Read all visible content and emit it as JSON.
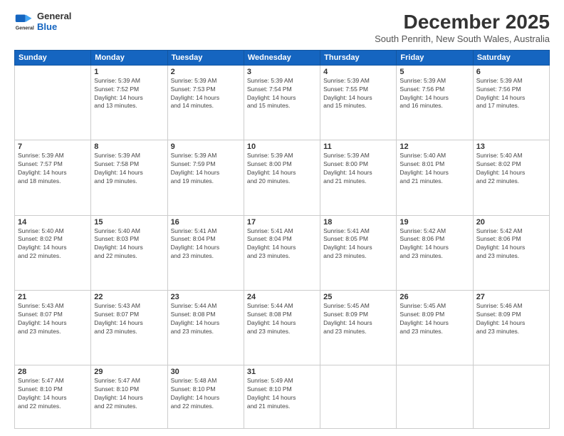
{
  "logo": {
    "line1": "General",
    "line2": "Blue"
  },
  "title": "December 2025",
  "subtitle": "South Penrith, New South Wales, Australia",
  "days_header": [
    "Sunday",
    "Monday",
    "Tuesday",
    "Wednesday",
    "Thursday",
    "Friday",
    "Saturday"
  ],
  "weeks": [
    [
      {
        "num": "",
        "info": ""
      },
      {
        "num": "1",
        "info": "Sunrise: 5:39 AM\nSunset: 7:52 PM\nDaylight: 14 hours\nand 13 minutes."
      },
      {
        "num": "2",
        "info": "Sunrise: 5:39 AM\nSunset: 7:53 PM\nDaylight: 14 hours\nand 14 minutes."
      },
      {
        "num": "3",
        "info": "Sunrise: 5:39 AM\nSunset: 7:54 PM\nDaylight: 14 hours\nand 15 minutes."
      },
      {
        "num": "4",
        "info": "Sunrise: 5:39 AM\nSunset: 7:55 PM\nDaylight: 14 hours\nand 15 minutes."
      },
      {
        "num": "5",
        "info": "Sunrise: 5:39 AM\nSunset: 7:56 PM\nDaylight: 14 hours\nand 16 minutes."
      },
      {
        "num": "6",
        "info": "Sunrise: 5:39 AM\nSunset: 7:56 PM\nDaylight: 14 hours\nand 17 minutes."
      }
    ],
    [
      {
        "num": "7",
        "info": "Sunrise: 5:39 AM\nSunset: 7:57 PM\nDaylight: 14 hours\nand 18 minutes."
      },
      {
        "num": "8",
        "info": "Sunrise: 5:39 AM\nSunset: 7:58 PM\nDaylight: 14 hours\nand 19 minutes."
      },
      {
        "num": "9",
        "info": "Sunrise: 5:39 AM\nSunset: 7:59 PM\nDaylight: 14 hours\nand 19 minutes."
      },
      {
        "num": "10",
        "info": "Sunrise: 5:39 AM\nSunset: 8:00 PM\nDaylight: 14 hours\nand 20 minutes."
      },
      {
        "num": "11",
        "info": "Sunrise: 5:39 AM\nSunset: 8:00 PM\nDaylight: 14 hours\nand 21 minutes."
      },
      {
        "num": "12",
        "info": "Sunrise: 5:40 AM\nSunset: 8:01 PM\nDaylight: 14 hours\nand 21 minutes."
      },
      {
        "num": "13",
        "info": "Sunrise: 5:40 AM\nSunset: 8:02 PM\nDaylight: 14 hours\nand 22 minutes."
      }
    ],
    [
      {
        "num": "14",
        "info": "Sunrise: 5:40 AM\nSunset: 8:02 PM\nDaylight: 14 hours\nand 22 minutes."
      },
      {
        "num": "15",
        "info": "Sunrise: 5:40 AM\nSunset: 8:03 PM\nDaylight: 14 hours\nand 22 minutes."
      },
      {
        "num": "16",
        "info": "Sunrise: 5:41 AM\nSunset: 8:04 PM\nDaylight: 14 hours\nand 23 minutes."
      },
      {
        "num": "17",
        "info": "Sunrise: 5:41 AM\nSunset: 8:04 PM\nDaylight: 14 hours\nand 23 minutes."
      },
      {
        "num": "18",
        "info": "Sunrise: 5:41 AM\nSunset: 8:05 PM\nDaylight: 14 hours\nand 23 minutes."
      },
      {
        "num": "19",
        "info": "Sunrise: 5:42 AM\nSunset: 8:06 PM\nDaylight: 14 hours\nand 23 minutes."
      },
      {
        "num": "20",
        "info": "Sunrise: 5:42 AM\nSunset: 8:06 PM\nDaylight: 14 hours\nand 23 minutes."
      }
    ],
    [
      {
        "num": "21",
        "info": "Sunrise: 5:43 AM\nSunset: 8:07 PM\nDaylight: 14 hours\nand 23 minutes."
      },
      {
        "num": "22",
        "info": "Sunrise: 5:43 AM\nSunset: 8:07 PM\nDaylight: 14 hours\nand 23 minutes."
      },
      {
        "num": "23",
        "info": "Sunrise: 5:44 AM\nSunset: 8:08 PM\nDaylight: 14 hours\nand 23 minutes."
      },
      {
        "num": "24",
        "info": "Sunrise: 5:44 AM\nSunset: 8:08 PM\nDaylight: 14 hours\nand 23 minutes."
      },
      {
        "num": "25",
        "info": "Sunrise: 5:45 AM\nSunset: 8:09 PM\nDaylight: 14 hours\nand 23 minutes."
      },
      {
        "num": "26",
        "info": "Sunrise: 5:45 AM\nSunset: 8:09 PM\nDaylight: 14 hours\nand 23 minutes."
      },
      {
        "num": "27",
        "info": "Sunrise: 5:46 AM\nSunset: 8:09 PM\nDaylight: 14 hours\nand 23 minutes."
      }
    ],
    [
      {
        "num": "28",
        "info": "Sunrise: 5:47 AM\nSunset: 8:10 PM\nDaylight: 14 hours\nand 22 minutes."
      },
      {
        "num": "29",
        "info": "Sunrise: 5:47 AM\nSunset: 8:10 PM\nDaylight: 14 hours\nand 22 minutes."
      },
      {
        "num": "30",
        "info": "Sunrise: 5:48 AM\nSunset: 8:10 PM\nDaylight: 14 hours\nand 22 minutes."
      },
      {
        "num": "31",
        "info": "Sunrise: 5:49 AM\nSunset: 8:10 PM\nDaylight: 14 hours\nand 21 minutes."
      },
      {
        "num": "",
        "info": ""
      },
      {
        "num": "",
        "info": ""
      },
      {
        "num": "",
        "info": ""
      }
    ]
  ]
}
